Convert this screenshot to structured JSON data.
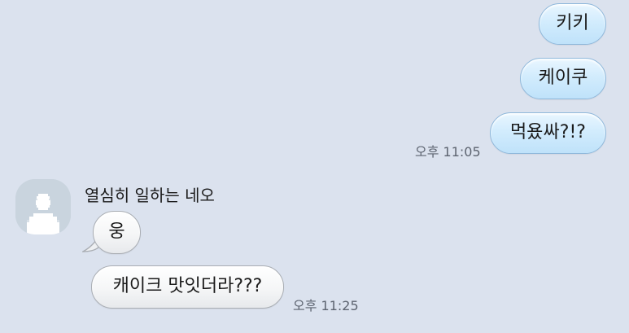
{
  "chat": {
    "outgoing": [
      {
        "text": "키키"
      },
      {
        "text": "케이쿠"
      },
      {
        "text": "먹욨싸?!?"
      }
    ],
    "outgoing_time": "오후 11:05",
    "incoming": {
      "sender_name": "열심히 일하는 네오",
      "messages": [
        {
          "text": "웅"
        },
        {
          "text": "캐이크 맛잇더라???"
        }
      ],
      "time": "오후 11:25",
      "avatar_icon": "default-profile-icon"
    }
  },
  "colors": {
    "background": "#dbe2ee",
    "outgoing_bubble": "#cfe9fc",
    "outgoing_border": "#8fb8db",
    "incoming_bubble": "#f4f5f6",
    "incoming_border": "#a9adb3",
    "avatar_bg": "#c9d4de"
  }
}
